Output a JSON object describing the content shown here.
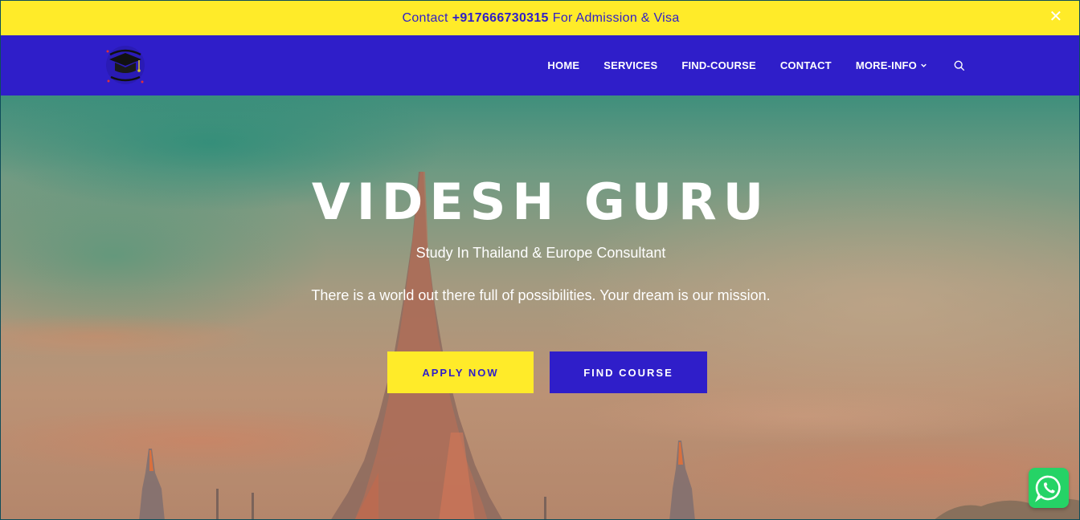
{
  "topbar": {
    "prefix": "Contact",
    "phone": "+917666730315",
    "suffix": "For Admission & Visa",
    "close_icon": "close-icon"
  },
  "nav": {
    "logo_icon": "graduation-cap-logo",
    "items": [
      {
        "label": "HOME"
      },
      {
        "label": "SERVICES"
      },
      {
        "label": "FIND-COURSE"
      },
      {
        "label": "CONTACT"
      },
      {
        "label": "MORE-INFO"
      }
    ],
    "search_icon": "search-icon"
  },
  "hero": {
    "title": "VIDESH GURU",
    "subtitle": "Study In Thailand & Europe Consultant",
    "tagline": "There is a world out there full of possibilities. Your dream is our mission.",
    "apply_label": "APPLY NOW",
    "find_label": "FIND COURSE"
  },
  "widgets": {
    "whatsapp_icon": "whatsapp-icon"
  },
  "colors": {
    "accent_yellow": "#ffeb29",
    "brand_blue": "#2f1ec9",
    "whatsapp_green": "#25d366"
  }
}
